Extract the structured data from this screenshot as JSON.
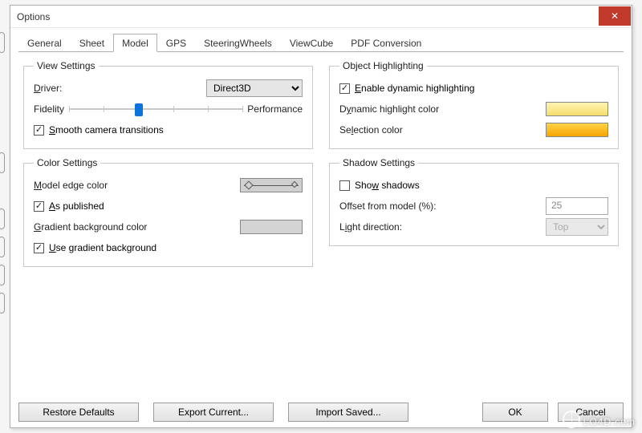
{
  "window": {
    "title": "Options"
  },
  "tabs": {
    "items": [
      "General",
      "Sheet",
      "Model",
      "GPS",
      "SteeringWheels",
      "ViewCube",
      "PDF Conversion"
    ],
    "active_index": 2
  },
  "view_settings": {
    "legend": "View Settings",
    "driver_label": "Driver:",
    "driver_value": "Direct3D",
    "fidelity_label": "Fidelity",
    "performance_label": "Performance",
    "slider_pos_pct": 40,
    "smooth_label": "Smooth camera transitions",
    "smooth_checked": true
  },
  "color_settings": {
    "legend": "Color Settings",
    "edge_label": "Model edge color",
    "as_published_label": "As published",
    "as_published_checked": true,
    "gradient_label": "Gradient background color",
    "use_gradient_label": "Use gradient background",
    "use_gradient_checked": true
  },
  "object_highlighting": {
    "legend": "Object Highlighting",
    "enable_label": "Enable dynamic highlighting",
    "enable_checked": true,
    "dynamic_color_label": "Dynamic highlight color",
    "dynamic_color_value": "#f6e27a",
    "selection_color_label": "Selection color",
    "selection_color_value": "#f6b800"
  },
  "shadow_settings": {
    "legend": "Shadow Settings",
    "show_label": "Show shadows",
    "show_checked": false,
    "offset_label": "Offset from model (%):",
    "offset_value": "25",
    "light_label": "Light direction:",
    "light_value": "Top"
  },
  "footer": {
    "restore": "Restore Defaults",
    "export": "Export Current...",
    "import": "Import Saved...",
    "ok": "OK",
    "cancel": "Cancel"
  },
  "watermark": "LO4D.com"
}
